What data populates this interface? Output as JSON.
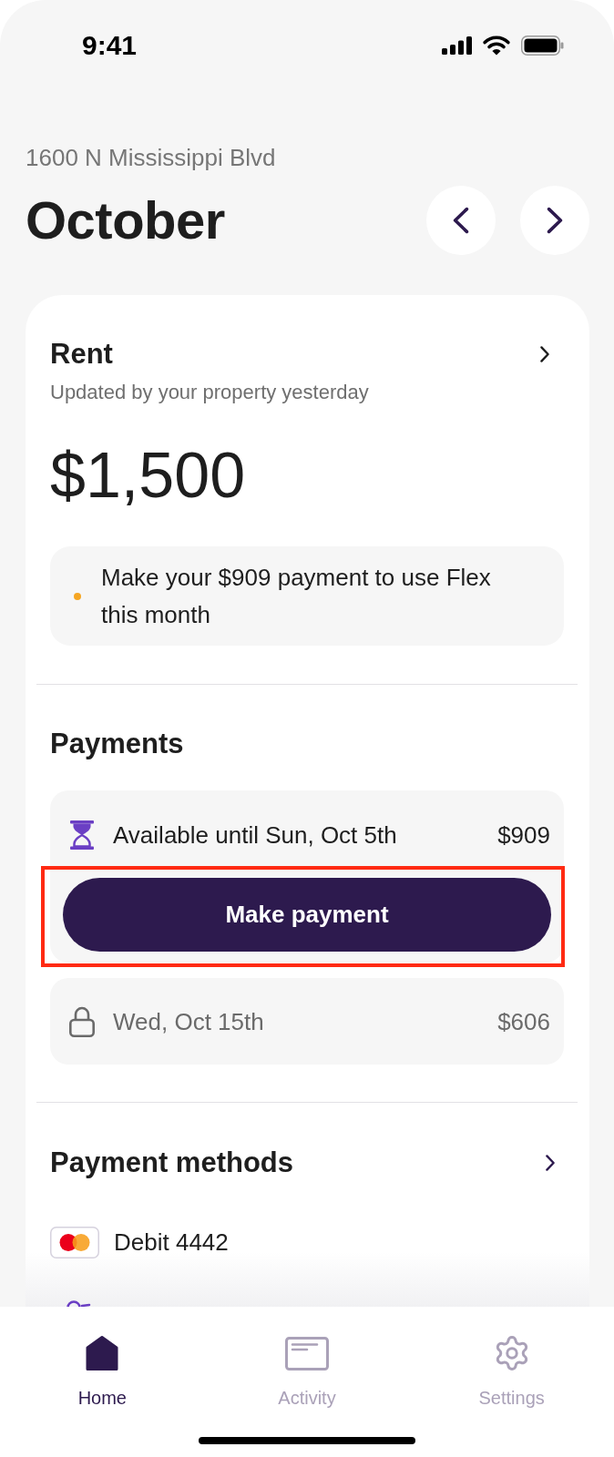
{
  "status_bar": {
    "time": "9:41"
  },
  "header": {
    "address": "1600 N Mississippi Blvd",
    "month": "October"
  },
  "rent": {
    "title": "Rent",
    "subtitle": "Updated by your property yesterday",
    "amount": "$1,500",
    "notice": "Make your $909 payment to use Flex this month"
  },
  "payments": {
    "title": "Payments",
    "items": [
      {
        "kind": "available",
        "label": "Available until Sun, Oct 5th",
        "amount": "$909",
        "button": {
          "label": "Make payment",
          "highlighted": true
        }
      },
      {
        "kind": "locked",
        "label": "Wed, Oct 15th",
        "amount": "$606"
      }
    ]
  },
  "payment_methods": {
    "title": "Payment methods",
    "items": [
      {
        "kind": "card",
        "label": "Debit 4442"
      },
      {
        "kind": "partial"
      }
    ]
  },
  "tab_bar": {
    "tabs": [
      {
        "kind": "home",
        "label": "Home",
        "selected": true
      },
      {
        "kind": "activity",
        "label": "Activity",
        "selected": false
      },
      {
        "kind": "settings",
        "label": "Settings",
        "selected": false
      }
    ]
  }
}
